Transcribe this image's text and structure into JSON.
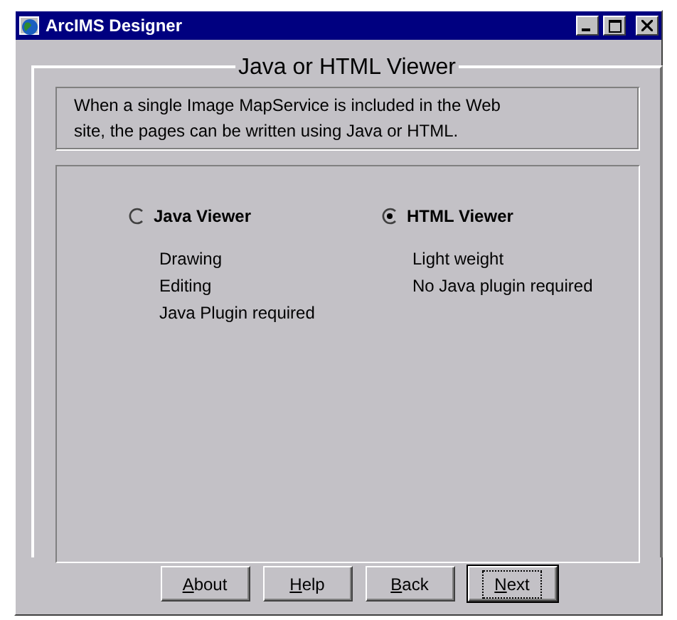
{
  "window": {
    "title": "ArcIMS Designer"
  },
  "group": {
    "title": "Java or HTML Viewer",
    "description": "When a single Image MapService is included in the Web site, the pages can be written using Java or HTML."
  },
  "options": [
    {
      "label": "Java Viewer",
      "selected": false,
      "features": [
        "Drawing",
        "Editing",
        "Java Plugin required"
      ]
    },
    {
      "label": "HTML Viewer",
      "selected": true,
      "features": [
        "Light weight",
        "No Java plugin required"
      ]
    }
  ],
  "buttons": [
    {
      "label": "About",
      "focused": false
    },
    {
      "label": "Help",
      "focused": false
    },
    {
      "label": "Back",
      "focused": false
    },
    {
      "label": "Next",
      "focused": true
    }
  ]
}
